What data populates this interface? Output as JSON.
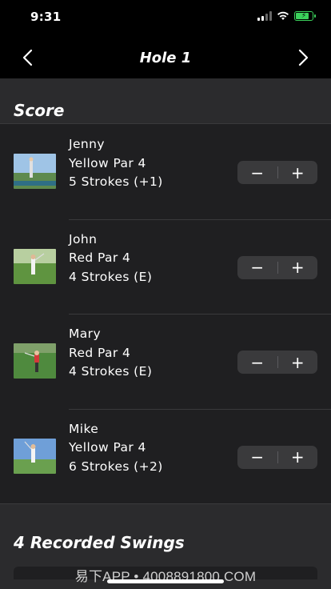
{
  "status_bar": {
    "time": "9:31"
  },
  "nav": {
    "title": "Hole 1",
    "back_icon": "chevron-left-icon",
    "forward_icon": "chevron-right-icon"
  },
  "score_section": {
    "title": "Score"
  },
  "players": [
    {
      "name": "Jenny",
      "tee_par": "Yellow Par 4",
      "strokes": "5 Strokes (+1)"
    },
    {
      "name": "John",
      "tee_par": "Red Par 4",
      "strokes": "4 Strokes (E)"
    },
    {
      "name": "Mary",
      "tee_par": "Red Par 4",
      "strokes": "4 Strokes (E)"
    },
    {
      "name": "Mike",
      "tee_par": "Yellow Par 4",
      "strokes": "6 Strokes (+2)"
    }
  ],
  "stepper": {
    "minus": "−",
    "plus": "+"
  },
  "swings_section": {
    "title": "4 Recorded Swings"
  },
  "watermark": "易下APP • 4008891800.COM",
  "colors": {
    "background": "#000000",
    "content_bg": "#2b2b2d",
    "list_bg": "#1f1f21",
    "stepper_bg": "#3a3a3c",
    "battery": "#3bd15b"
  }
}
